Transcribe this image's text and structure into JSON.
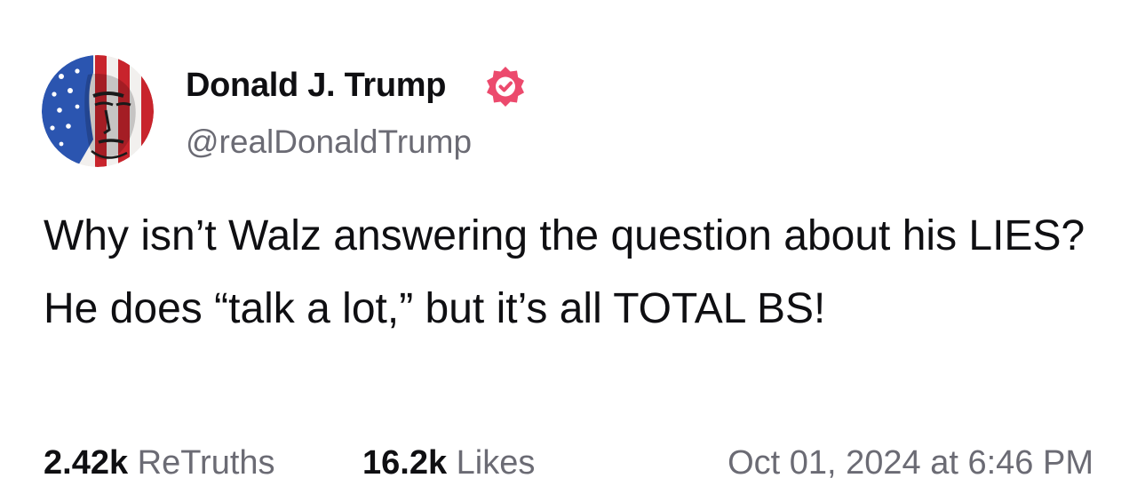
{
  "author": {
    "display_name": "Donald J. Trump",
    "handle": "@realDonaldTrump",
    "verified": true,
    "verified_badge_color": "#ec4a6d",
    "avatar_icon": "stars-and-stripes-portrait-avatar"
  },
  "post": {
    "text": "Why isn’t Walz answering the question about his LIES? He does “talk a lot,” but it’s all TOTAL BS!"
  },
  "stats": {
    "retruths_count": "2.42k",
    "retruths_label": "ReTruths",
    "likes_count": "16.2k",
    "likes_label": "Likes"
  },
  "timestamp": "Oct 01, 2024 at 6:46 PM",
  "colors": {
    "text_primary": "#0f0f12",
    "text_secondary": "#6b6b74",
    "background": "#ffffff"
  }
}
